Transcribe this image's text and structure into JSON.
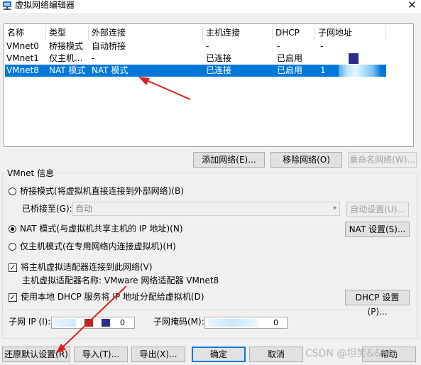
{
  "window": {
    "title": "虚拟网络编辑器",
    "close_glyph": "✕",
    "icon": "network-icon"
  },
  "table": {
    "columns": [
      "名称",
      "类型",
      "外部连接",
      "主机连接",
      "DHCP",
      "子网地址"
    ],
    "rows": [
      {
        "name": "VMnet0",
        "type": "桥接模式",
        "external": "自动桥接",
        "host": "-",
        "dhcp": "-",
        "subnet": "-"
      },
      {
        "name": "VMnet1",
        "type": "仅主机...",
        "external": "-",
        "host": "已连接",
        "dhcp": "已启用",
        "subnet": ""
      },
      {
        "name": "VMnet8",
        "type": "NAT 模式",
        "external": "NAT 模式",
        "host": "已连接",
        "dhcp": "已启用",
        "subnet": "1"
      }
    ],
    "selected_row": "VMnet8"
  },
  "buttons": {
    "add_network": "添加网络(E)...",
    "remove_network": "移除网络(O)",
    "rename_network": "重命名网络(W)...",
    "auto_settings": "自动设置(U)...",
    "nat_settings": "NAT 设置(S)...",
    "dhcp_settings": "DHCP 设置(P)...",
    "restore_defaults": "还原默认设置(R)",
    "import": "导入(T)...",
    "export": "导出(X)...",
    "ok": "确定",
    "cancel": "取消",
    "help": "帮助"
  },
  "vmnet_info": {
    "group_label": "VMnet 信息",
    "bridged_mode": "桥接模式(将虚拟机直接连接到外部网络)(B)",
    "bridged_to_label": "已桥接至(G):",
    "bridged_to_value": "自动",
    "nat_mode": "NAT 模式(与虚拟机共享主机的 IP 地址)(N)",
    "host_only_mode": "仅主机模式(在专用网络内连接虚拟机)(H)",
    "selected_mode": "nat",
    "connect_adapter": "将主机虚拟适配器连接到此网络(V)",
    "connect_adapter_checked": true,
    "adapter_name": "主机虚拟适配器名称: VMware 网络适配器 VMnet8",
    "use_dhcp": "使用本地 DHCP 服务将 IP 地址分配给虚拟机(D)",
    "use_dhcp_checked": true,
    "subnet_ip_label": "子网 IP (I):",
    "subnet_ip_last": "0",
    "subnet_mask_label": "子网掩码(M):",
    "subnet_mask_last": "0"
  },
  "watermark": "CSDN @坦笑&&life",
  "colors": {
    "selection": "#0078d7",
    "annotation_arrow": "#e02020"
  }
}
